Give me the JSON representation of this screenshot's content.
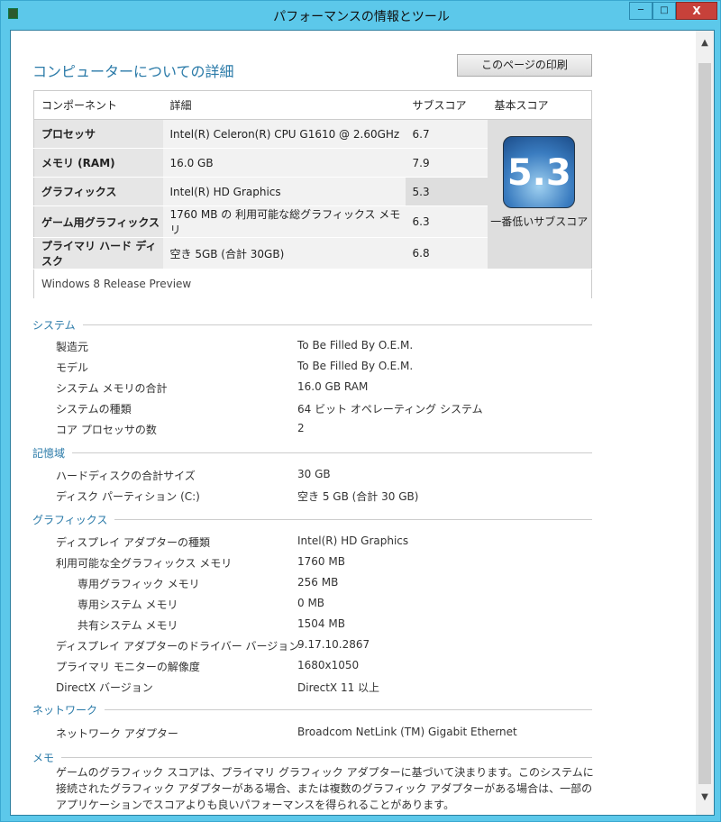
{
  "window": {
    "title": "パフォーマンスの情報とツール",
    "minimize": "─",
    "maximize": "□",
    "close": "X"
  },
  "header": {
    "title": "コンピューターについての詳細",
    "print_button": "このページの印刷"
  },
  "score_table": {
    "headers": [
      "コンポーネント",
      "詳細",
      "サブスコア",
      "基本スコア"
    ],
    "rows": [
      {
        "component": "プロセッサ",
        "detail": "Intel(R) Celeron(R) CPU G1610 @ 2.60GHz",
        "subscore": "6.7"
      },
      {
        "component": "メモリ (RAM)",
        "detail": "16.0 GB",
        "subscore": "7.9"
      },
      {
        "component": "グラフィックス",
        "detail": "Intel(R) HD Graphics",
        "subscore": "5.3"
      },
      {
        "component": "ゲーム用グラフィックス",
        "detail": "1760 MB の 利用可能な総グラフィックス メモリ",
        "subscore": "6.3"
      },
      {
        "component": "プライマリ ハード ディスク",
        "detail": "空き 5GB (合計 30GB)",
        "subscore": "6.8"
      }
    ],
    "base_score": "5.3",
    "base_caption": "一番低いサブスコア",
    "footer": "Windows 8 Release Preview"
  },
  "sections": [
    {
      "title": "システム",
      "items": [
        [
          "製造元",
          "To Be Filled By O.E.M."
        ],
        [
          "モデル",
          "To Be Filled By O.E.M."
        ],
        [
          "システム メモリの合計",
          "16.0 GB RAM"
        ],
        [
          "システムの種類",
          "64 ビット オペレーティング システム"
        ],
        [
          "コア プロセッサの数",
          "2"
        ]
      ]
    },
    {
      "title": "記憶域",
      "items": [
        [
          "ハードディスクの合計サイズ",
          "30 GB"
        ],
        [
          "ディスク パーティション (C:)",
          "空き 5 GB (合計 30 GB)"
        ]
      ]
    },
    {
      "title": "グラフィックス",
      "items": [
        [
          "ディスプレイ アダプターの種類",
          "Intel(R) HD Graphics"
        ],
        [
          "利用可能な全グラフィックス メモリ",
          "1760 MB"
        ],
        [
          "専用グラフィック メモリ",
          "256 MB"
        ],
        [
          "専用システム メモリ",
          "0 MB"
        ],
        [
          "共有システム メモリ",
          "1504 MB"
        ],
        [
          "ディスプレイ アダプターのドライバー バージョン",
          "9.17.10.2867"
        ],
        [
          "プライマリ モニターの解像度",
          "1680x1050"
        ],
        [
          "DirectX バージョン",
          "DirectX 11 以上"
        ]
      ]
    },
    {
      "title": "ネットワーク",
      "items": [
        [
          "ネットワーク アダプター",
          "Broadcom NetLink (TM) Gigabit Ethernet"
        ]
      ]
    },
    {
      "title": "メモ",
      "items": []
    }
  ],
  "memo": "ゲームのグラフィック スコアは、プライマリ グラフィック アダプターに基づいて決まります。このシステムに接続されたグラフィック アダプターがある場合、または複数のグラフィック アダプターがある場合は、一部のアプリケーションでスコアよりも良いパフォーマンスを得られることがあります。"
}
